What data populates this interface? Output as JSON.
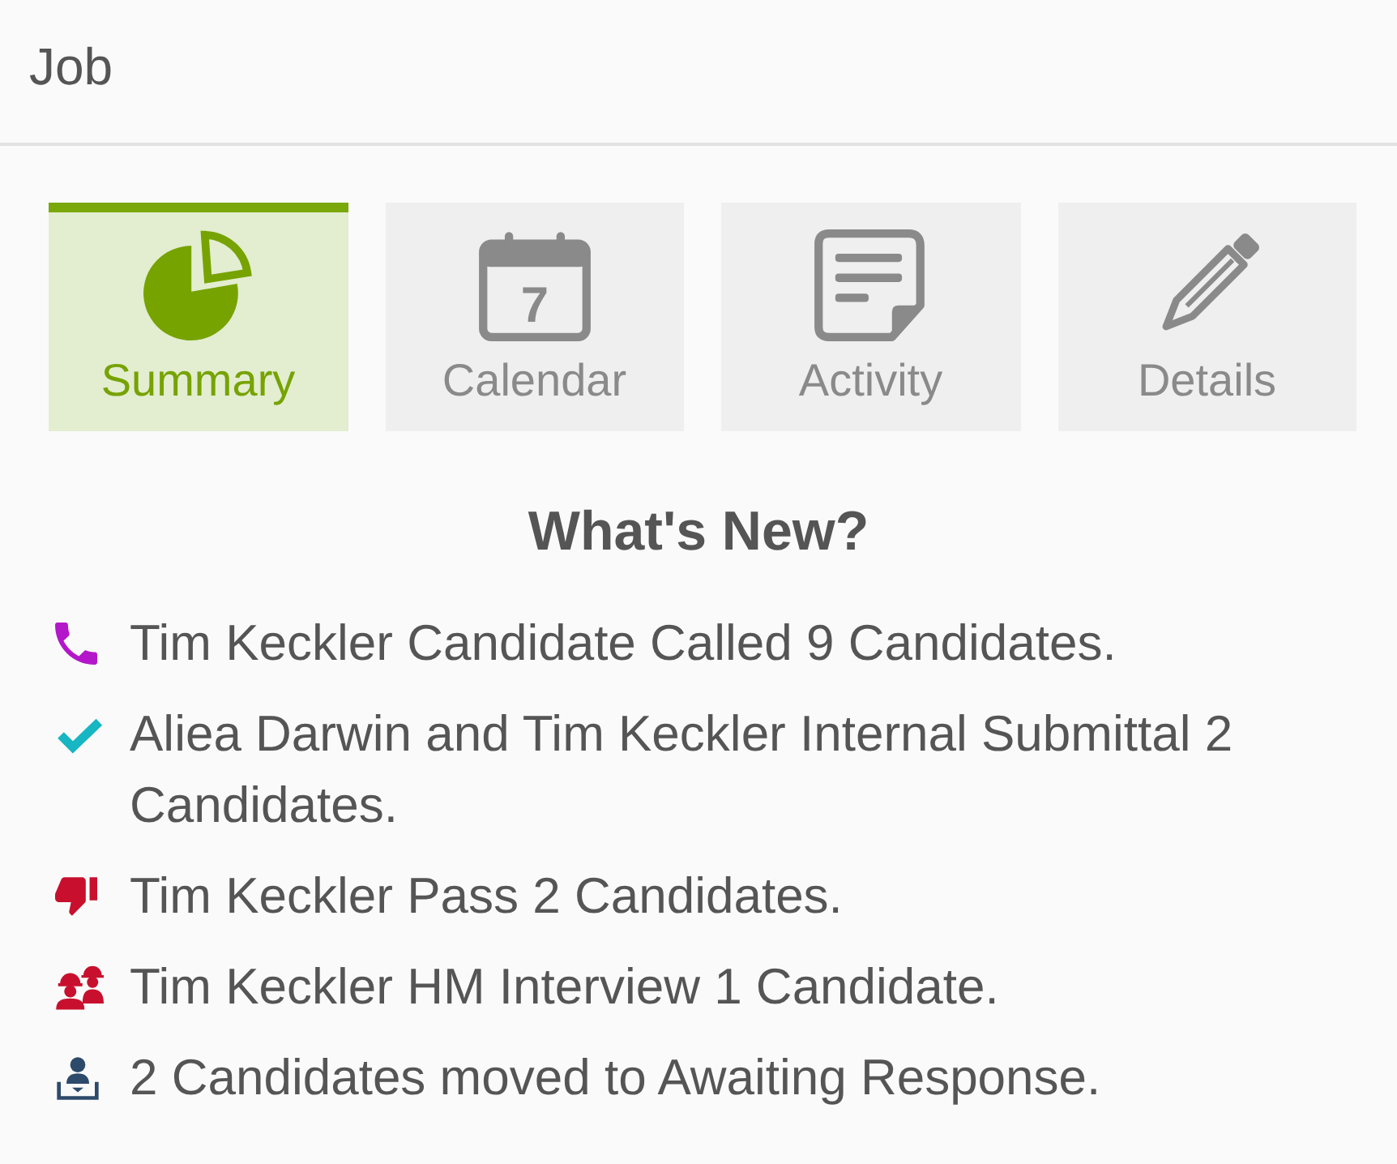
{
  "header": {
    "title": "Job"
  },
  "tabs": [
    {
      "kind": "chart",
      "label": "Summary",
      "selected": true
    },
    {
      "kind": "calendar",
      "label": "Calendar",
      "selected": false,
      "icon_text": "7"
    },
    {
      "kind": "note",
      "label": "Activity",
      "selected": false
    },
    {
      "kind": "pencil",
      "label": "Details",
      "selected": false
    }
  ],
  "whats_new": {
    "title": "What's New?",
    "items": [
      {
        "kind": "call",
        "text": "Tim Keckler Candidate Called 9 Candidates."
      },
      {
        "kind": "submittal",
        "text": "Aliea Darwin and Tim Keckler Internal Submittal 2 Candidates."
      },
      {
        "kind": "pass",
        "text": "Tim Keckler Pass 2 Candidates."
      },
      {
        "kind": "interview",
        "text": "Tim Keckler HM Interview 1 Candidate."
      },
      {
        "kind": "moved",
        "text": "2 Candidates moved to Awaiting Response."
      }
    ]
  }
}
